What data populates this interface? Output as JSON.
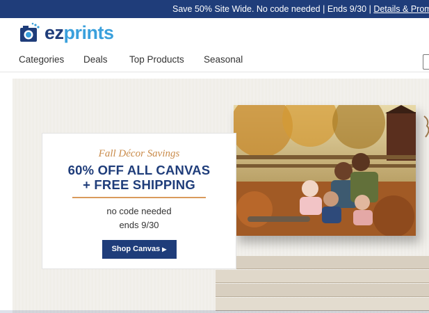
{
  "promo_bar": {
    "text": "Save 50% Site Wide. No code needed | Ends 9/30 |",
    "link": "Details & Promotions"
  },
  "brand": {
    "part1": "ez",
    "part2": "prints",
    "icon": "camera-icon"
  },
  "nav": {
    "items": [
      "Categories",
      "Deals",
      "Top Products",
      "Seasonal"
    ]
  },
  "hero": {
    "subtitle": "Fall Décor Savings",
    "headline_line1": "60% OFF ALL CANVAS",
    "headline_line2": "+ FREE SHIPPING",
    "note_line1": "no code needed",
    "note_line2": "ends 9/30",
    "cta_label": "Shop Canvas",
    "cta_icon": "caret-right-icon",
    "photo": "family-autumn-canvas-photo"
  },
  "colors": {
    "brand_navy": "#1f3d7a",
    "brand_blue": "#3aa0dc",
    "accent_orange": "#d99a5c"
  }
}
